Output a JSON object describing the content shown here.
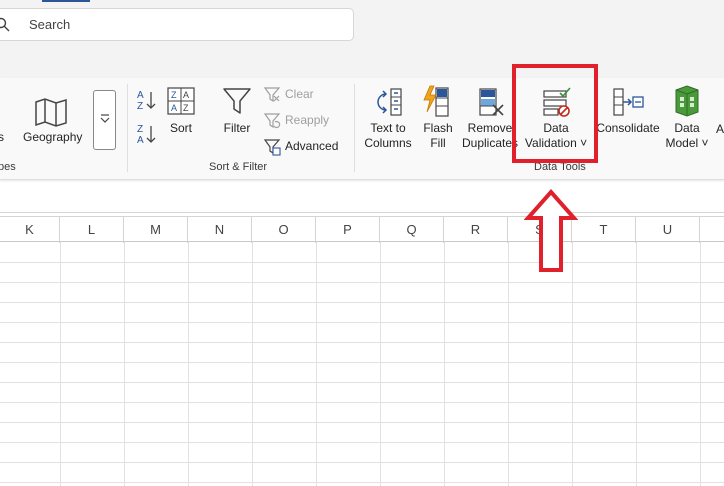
{
  "search": {
    "placeholder": "Search"
  },
  "ribbon": {
    "geography": {
      "label": "Geography"
    },
    "groups": {
      "data_types_label": "pes",
      "sort_filter_label": "Sort & Filter",
      "data_tools_label": "Data Tools"
    },
    "sort": {
      "label": "Sort"
    },
    "filter": {
      "label": "Filter"
    },
    "clear": {
      "label": "Clear"
    },
    "reapply": {
      "label": "Reapply"
    },
    "advanced": {
      "label": "Advanced"
    },
    "text_to_columns": {
      "line1": "Text to",
      "line2": "Columns"
    },
    "flash_fill": {
      "line1": "Flash",
      "line2": "Fill"
    },
    "remove_duplicates": {
      "line1": "Remove",
      "line2": "Duplicates"
    },
    "data_validation": {
      "line1": "Data",
      "line2": "Validation ˅"
    },
    "consolidate": {
      "label": "Consolidate"
    },
    "data_model": {
      "line1": "Data",
      "line2": "Model ˅"
    },
    "partial_left": "s",
    "partial_right": "A"
  },
  "sheet": {
    "columns": [
      "K",
      "L",
      "M",
      "N",
      "O",
      "P",
      "Q",
      "R",
      "S",
      "T",
      "U"
    ]
  },
  "colors": {
    "highlight": "#e0202b",
    "accent": "#2b579a"
  }
}
